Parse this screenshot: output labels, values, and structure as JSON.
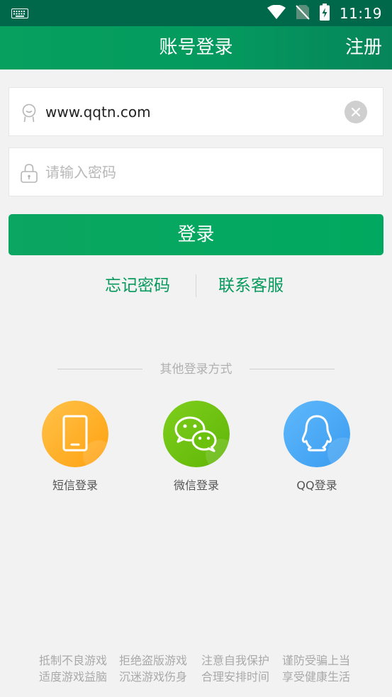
{
  "status_bar": {
    "time": "11:19",
    "icons": [
      "keyboard-icon",
      "wifi-icon",
      "no-sim-icon",
      "battery-charging-icon"
    ]
  },
  "header": {
    "title": "账号登录",
    "register_label": "注册"
  },
  "form": {
    "username": {
      "value": "www.qqtn.com",
      "icon": "user-icon"
    },
    "password": {
      "placeholder": "请输入密码",
      "icon": "lock-icon"
    },
    "login_label": "登录"
  },
  "links": {
    "forgot_label": "忘记密码",
    "service_label": "联系客服"
  },
  "other_login": {
    "title": "其他登录方式",
    "methods": [
      {
        "label": "短信登录",
        "icon": "phone-icon",
        "color": "#ffac1c"
      },
      {
        "label": "微信登录",
        "icon": "wechat-icon",
        "color": "#6cc00e"
      },
      {
        "label": "QQ登录",
        "icon": "qq-icon",
        "color": "#4aa9f5"
      }
    ]
  },
  "footer": {
    "line1": [
      "抵制不良游戏",
      "拒绝盗版游戏",
      "注意自我保护",
      "谨防受骗上当"
    ],
    "line2": [
      "适度游戏益脑",
      "沉迷游戏伤身",
      "合理安排时间",
      "享受健康生活"
    ]
  },
  "colors": {
    "brand_green": "#00a95f",
    "status_bar": "#00684a",
    "link_green": "#079a5c"
  }
}
